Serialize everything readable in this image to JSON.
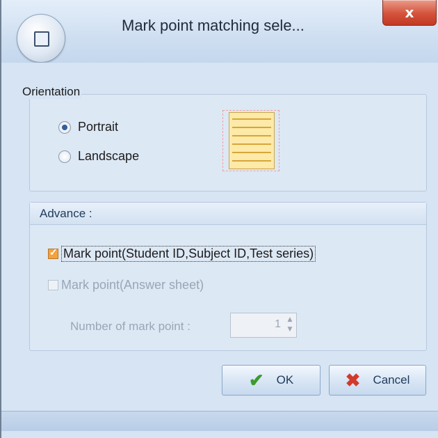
{
  "window": {
    "title": "Mark point matching sele...",
    "close_glyph": "x",
    "app_icon": "window-frame-icon"
  },
  "orientation": {
    "title": "Orientation",
    "options": [
      {
        "label": "Portrait",
        "checked": true
      },
      {
        "label": "Landscape",
        "checked": false
      }
    ],
    "preview_icon": "portrait-page-icon"
  },
  "advance": {
    "title": "Advance :",
    "mark_point_ids": {
      "label": "Mark point(Student ID,Subject ID,Test series)",
      "checked": true
    },
    "mark_point_answer": {
      "label": "Mark point(Answer sheet)",
      "checked": false,
      "enabled": false
    },
    "number_label": "Number of mark point :",
    "number_value": "1"
  },
  "buttons": {
    "ok": "OK",
    "cancel": "Cancel"
  },
  "colors": {
    "accent": "#f5a23a",
    "close": "#d4523a",
    "frame": "#d6e4f3"
  }
}
